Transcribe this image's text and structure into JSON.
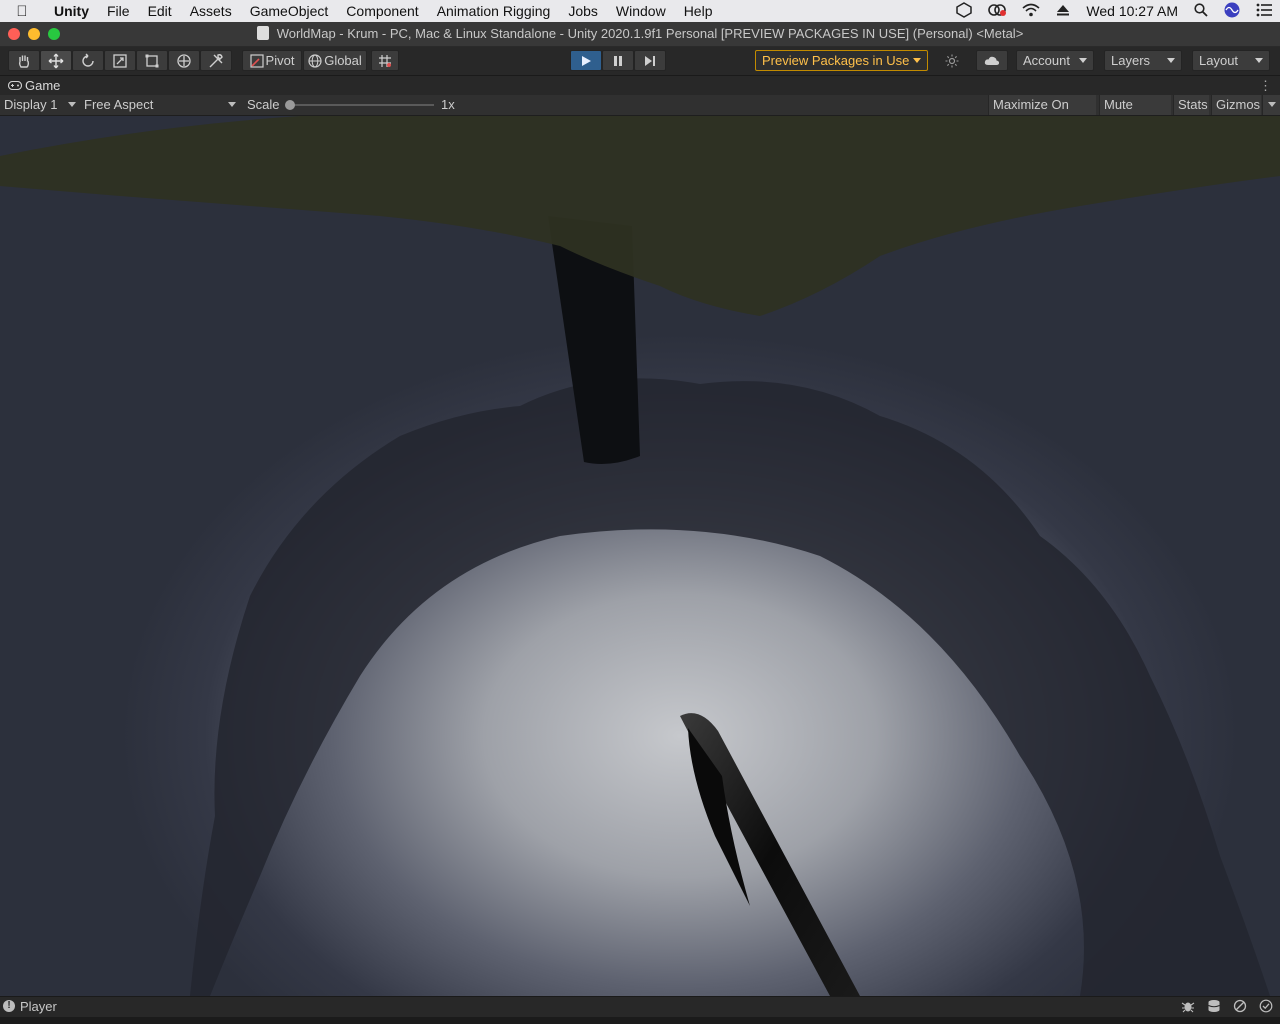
{
  "menubar": {
    "app_name": "Unity",
    "items": [
      "File",
      "Edit",
      "Assets",
      "GameObject",
      "Component",
      "Animation Rigging",
      "Jobs",
      "Window",
      "Help"
    ],
    "clock": "Wed 10:27 AM"
  },
  "window": {
    "title": "WorldMap - Krum - PC, Mac & Linux Standalone - Unity 2020.1.9f1 Personal [PREVIEW PACKAGES IN USE] (Personal) <Metal>"
  },
  "toolbar": {
    "pivot_label": "Pivot",
    "global_label": "Global",
    "preview_packages_label": "Preview Packages in Use",
    "account_label": "Account",
    "layers_label": "Layers",
    "layout_label": "Layout"
  },
  "tab": {
    "label": "Game"
  },
  "gamebar": {
    "display_value": "Display 1",
    "aspect_value": "Free Aspect",
    "scale_label": "Scale",
    "scale_value": "1x",
    "maximize_label": "Maximize On Play",
    "mute_label": "Mute Audio",
    "stats_label": "Stats",
    "gizmos_label": "Gizmos"
  },
  "status": {
    "text": "Player"
  },
  "colors": {
    "accent_play": "#2f5f8e",
    "preview_warning": "#ffc04a",
    "editor_bg": "#282828"
  }
}
